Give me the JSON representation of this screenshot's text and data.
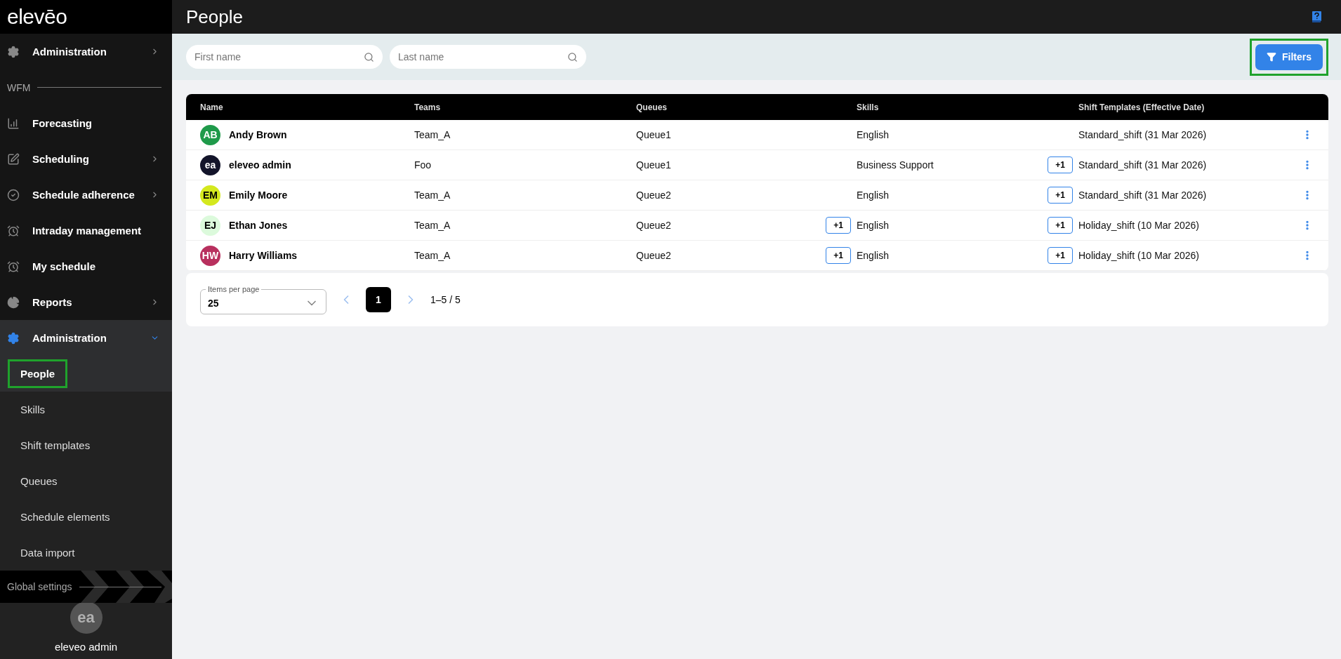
{
  "logo": "elevēo",
  "header": {
    "title": "People"
  },
  "sidebar": {
    "items": [
      {
        "kind": "item",
        "label": "Administration",
        "expandable": true,
        "expanded": false
      },
      {
        "kind": "section",
        "label": "WFM"
      },
      {
        "kind": "item",
        "label": "Forecasting",
        "expandable": false
      },
      {
        "kind": "item",
        "label": "Scheduling",
        "expandable": true,
        "expanded": false
      },
      {
        "kind": "item",
        "label": "Schedule adherence",
        "expandable": true,
        "expanded": false
      },
      {
        "kind": "item",
        "label": "Intraday management",
        "expandable": false
      },
      {
        "kind": "item",
        "label": "My schedule",
        "expandable": false
      },
      {
        "kind": "item",
        "label": "Reports",
        "expandable": true,
        "expanded": false
      },
      {
        "kind": "item",
        "label": "Administration",
        "expandable": true,
        "expanded": true,
        "children": [
          {
            "label": "People",
            "selected": true,
            "highlighted": true
          },
          {
            "label": "Skills",
            "selected": false,
            "highlighted": false
          },
          {
            "label": "Shift templates",
            "selected": false,
            "highlighted": false
          },
          {
            "label": "Queues",
            "selected": false,
            "highlighted": false
          },
          {
            "label": "Schedule elements",
            "selected": false,
            "highlighted": false
          },
          {
            "label": "Data import",
            "selected": false,
            "highlighted": false
          }
        ]
      }
    ],
    "footer_section": "Global settings",
    "user": {
      "initials": "ea",
      "name": "eleveo admin"
    }
  },
  "search": {
    "first_name": {
      "placeholder": "First name"
    },
    "last_name": {
      "placeholder": "Last name"
    }
  },
  "filters_button": {
    "label": "Filters",
    "highlighted": true
  },
  "table": {
    "columns": [
      "Name",
      "Teams",
      "Queues",
      "Skills",
      "Shift Templates (Effective Date)"
    ],
    "rows": [
      {
        "initials": "AB",
        "color": "#1f9a4a",
        "name": "Andy Brown",
        "team": "Team_A",
        "queue": "Queue1",
        "skill": "English",
        "shift": "Standard_shift (31 Mar 2026)"
      },
      {
        "initials": "ea",
        "color": "#13142a",
        "name": "eleveo admin",
        "team": "Foo",
        "queue": "Queue1",
        "skill": "Business Support",
        "skill_more": "+1",
        "shift": "Standard_shift (31 Mar 2026)"
      },
      {
        "initials": "EM",
        "color": "#d4e81e",
        "name": "Emily Moore",
        "team": "Team_A",
        "queue": "Queue2",
        "skill": "English",
        "skill_more": "+1",
        "shift": "Standard_shift (31 Mar 2026)"
      },
      {
        "initials": "EJ",
        "color": "#dcfadc",
        "name": "Ethan Jones",
        "team": "Team_A",
        "queue": "Queue2",
        "queue_more": "+1",
        "skill": "English",
        "skill_more": "+1",
        "shift": "Holiday_shift (10 Mar 2026)"
      },
      {
        "initials": "HW",
        "color": "#b8305e",
        "name": "Harry Williams",
        "team": "Team_A",
        "queue": "Queue2",
        "queue_more": "+1",
        "skill": "English",
        "skill_more": "+1",
        "shift": "Holiday_shift (10 Mar 2026)"
      }
    ]
  },
  "pagination": {
    "items_per_page_label": "Items per page",
    "items_per_page": "25",
    "pages": [
      {
        "label": "1",
        "selected": true
      }
    ],
    "range": "1–5 / 5"
  }
}
